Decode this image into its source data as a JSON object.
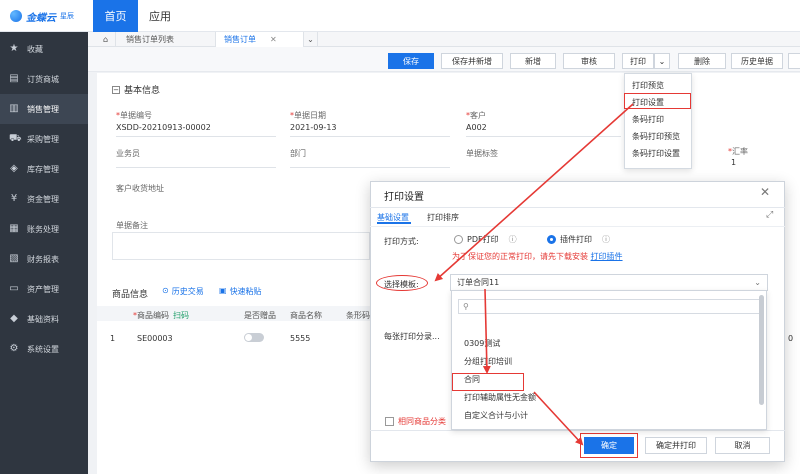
{
  "brand": {
    "name": "金蝶云",
    "sub": "星辰"
  },
  "top_tabs": {
    "home": "首页",
    "apps": "应用"
  },
  "sidebar": [
    {
      "icon": "star-icon",
      "label": "收藏"
    },
    {
      "icon": "mall-icon",
      "label": "订货商城"
    },
    {
      "icon": "bar-chart-icon",
      "label": "销售管理"
    },
    {
      "icon": "cart-icon",
      "label": "采购管理"
    },
    {
      "icon": "box-icon",
      "label": "库存管理"
    },
    {
      "icon": "money-icon",
      "label": "资金管理"
    },
    {
      "icon": "ledger-icon",
      "label": "账务处理"
    },
    {
      "icon": "report-icon",
      "label": "财务报表"
    },
    {
      "icon": "asset-icon",
      "label": "资产管理"
    },
    {
      "icon": "layers-icon",
      "label": "基础资料"
    },
    {
      "icon": "gear-icon",
      "label": "系统设置"
    }
  ],
  "page_tabs": {
    "list": "销售订单列表",
    "order": "销售订单"
  },
  "toolbar": {
    "save": "保存",
    "save_new": "保存并新增",
    "new": "新增",
    "audit": "审核",
    "print": "打印",
    "delete": "删除",
    "history": "历史单据"
  },
  "print_menu": [
    "打印预览",
    "打印设置",
    "条码打印",
    "条码打印预览",
    "条码打印设置"
  ],
  "basic": {
    "title": "基本信息",
    "bill_no_label": "单据编号",
    "bill_no": "XSDD-20210913-00002",
    "date_label": "单据日期",
    "date": "2021-09-13",
    "customer_label": "客户",
    "customer": "A002",
    "salesman_label": "业务员",
    "dept_label": "部门",
    "tag_label": "单据标签",
    "rate_label": "汇率",
    "rate": "1",
    "address_label": "客户收货地址",
    "remark_label": "单据备注"
  },
  "goods": {
    "title": "商品信息",
    "history": "历史交易",
    "paste": "快速粘贴",
    "col_code": "商品编码",
    "scan": "扫码",
    "col_gift": "是否赠品",
    "col_name": "商品名称",
    "col_spec": "条形码",
    "row_no": "1",
    "row_code": "SE00003",
    "row_name": "5555",
    "row_tail": "0"
  },
  "modal": {
    "title": "打印设置",
    "tab_basic": "基础设置",
    "tab_order": "打印排序",
    "method_label": "打印方式:",
    "opt_pdf": "PDF打印",
    "opt_plugin": "插件打印",
    "hint": "为了保证您的正常打印，请先下载安装",
    "hint_link": "打印插件",
    "tpl_label": "选择模板:",
    "tpl_value": "订单合同11",
    "multi_label": "每张打印分录...",
    "same_cat": "相同商品分类",
    "ok": "确定",
    "ok_print": "确定并打印",
    "cancel": "取消"
  },
  "templates": [
    "0309测试",
    "分组打印培训",
    "合同",
    "打印辅助属性无金额",
    "自定义合计与小计"
  ],
  "colors": {
    "accent": "#1a73e8",
    "sidebar": "#2f3640",
    "annotation": "#e53935"
  }
}
